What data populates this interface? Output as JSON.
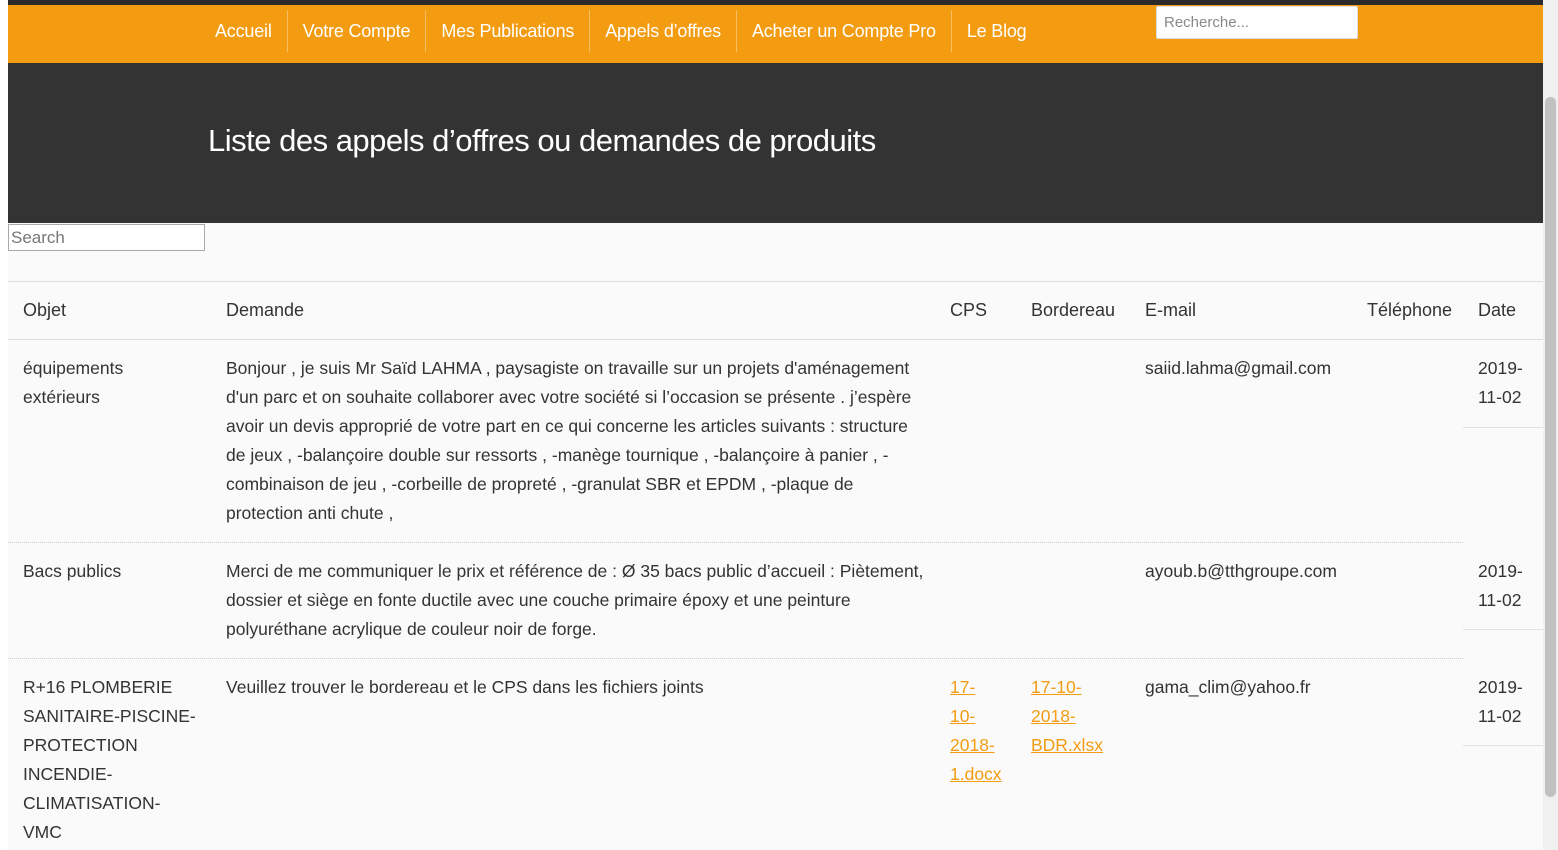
{
  "nav": {
    "items": [
      {
        "label": "Accueil"
      },
      {
        "label": "Votre Compte"
      },
      {
        "label": "Mes Publications"
      },
      {
        "label": "Appels d’offres"
      },
      {
        "label": "Acheter un Compte Pro"
      },
      {
        "label": "Le Blog"
      }
    ],
    "search_placeholder": "Recherche..."
  },
  "hero": {
    "title": "Liste des appels d’offres ou demandes de produits"
  },
  "table": {
    "search_placeholder": "Search",
    "headers": {
      "objet": "Objet",
      "demande": "Demande",
      "cps": "CPS",
      "bordereau": "Bordereau",
      "email": "E-mail",
      "telephone": "Téléphone",
      "date": "Date"
    },
    "rows": [
      {
        "objet_lines": [
          "équipements",
          "extérieurs"
        ],
        "demande_lines": [
          "Bonjour , je suis Mr Saïd LAHMA , paysagiste on travaille sur un projets d'aménagement",
          "d'un parc et on souhaite collaborer avec votre société si l’occasion se présente . j’espère",
          "avoir un devis approprié de votre part en ce qui concerne les articles suivants : structure",
          "de jeux , -balançoire double sur ressorts , -manège tournique , -balançoire à panier , -",
          "combinaison de jeu , -corbeille de propreté , -granulat SBR et EPDM , -plaque de",
          "protection anti chute ,"
        ],
        "cps_lines": [],
        "bordereau_lines": [],
        "email": "saiid.lahma@gmail.com",
        "telephone": "",
        "date_lines": [
          "2019-",
          "11-02"
        ]
      },
      {
        "objet_lines": [
          "Bacs publics"
        ],
        "demande_lines": [
          "Merci de me communiquer le prix et référence de : Ø 35 bacs public d’accueil : Piètement,",
          "dossier et siège en fonte ductile avec une couche primaire époxy et une peinture",
          "polyuréthane acrylique de couleur noir de forge."
        ],
        "cps_lines": [],
        "bordereau_lines": [],
        "email": "ayoub.b@tthgroupe.com",
        "telephone": "",
        "date_lines": [
          "2019-",
          "11-02"
        ]
      },
      {
        "objet_lines": [
          "R+16 PLOMBERIE",
          "SANITAIRE-PISCINE-",
          "PROTECTION",
          "INCENDIE-",
          "CLIMATISATION-",
          "VMC"
        ],
        "demande_lines": [
          "Veuillez trouver le bordereau et le CPS dans les fichiers joints"
        ],
        "cps_lines": [
          "17-",
          "10-",
          "2018-",
          "1.docx"
        ],
        "bordereau_lines": [
          "17-10-",
          "2018-",
          "BDR.xlsx"
        ],
        "email": "gama_clim@yahoo.fr",
        "telephone": "",
        "date_lines": [
          "2019-",
          "11-02"
        ]
      }
    ]
  }
}
